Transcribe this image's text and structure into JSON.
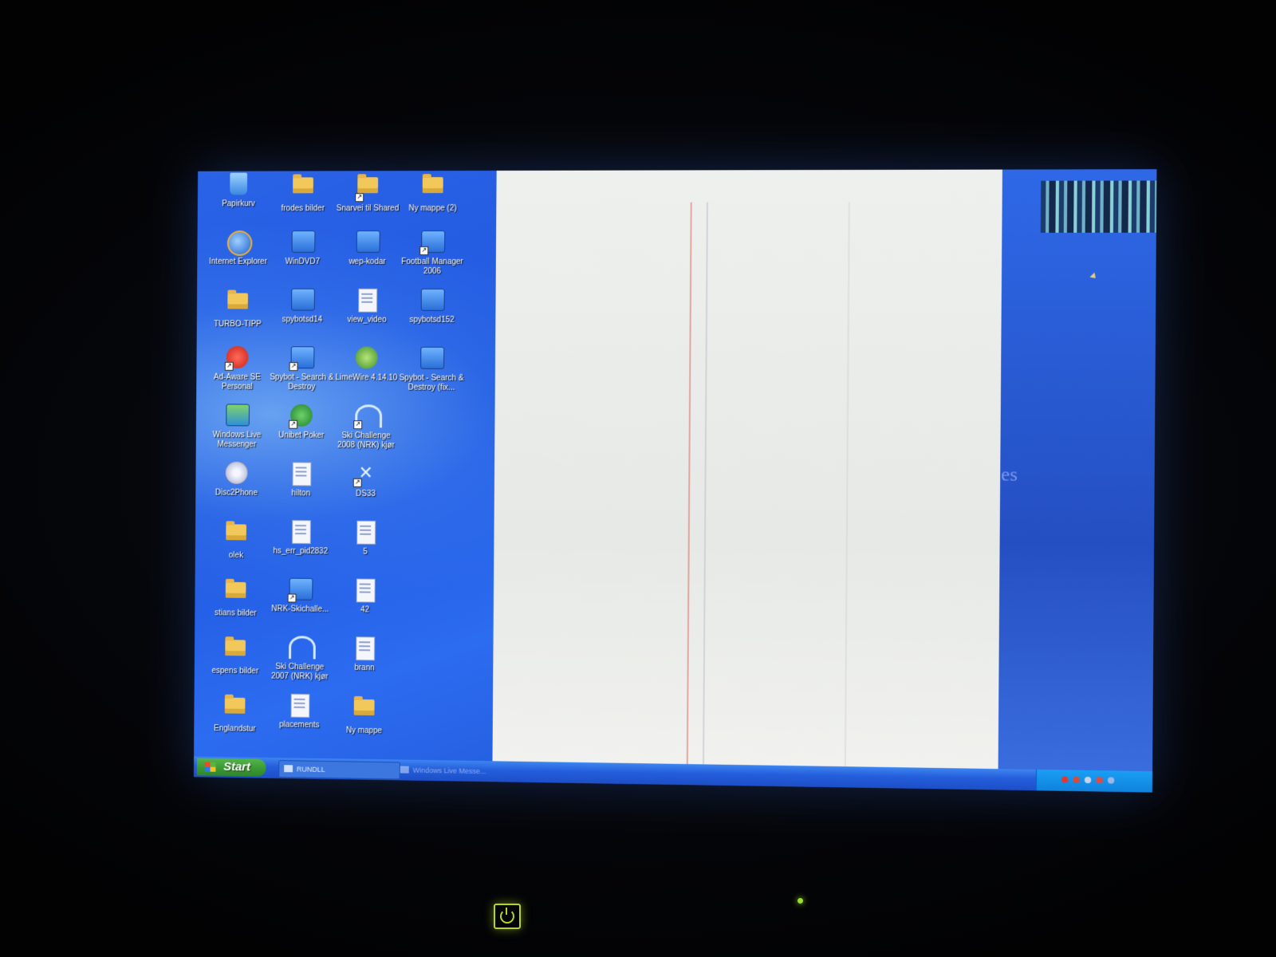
{
  "desktop": {
    "icons": [
      {
        "label": "Papirkurv",
        "type": "recycle"
      },
      {
        "label": "frodes bilder",
        "type": "folder"
      },
      {
        "label": "Snarvei til Shared",
        "type": "folder",
        "shortcut": true
      },
      {
        "label": "Ny mappe (2)",
        "type": "folder"
      },
      {
        "label": "Internet Explorer",
        "type": "ie"
      },
      {
        "label": "WinDVD7",
        "type": "app"
      },
      {
        "label": "wep-kodar",
        "type": "app"
      },
      {
        "label": "Football Manager 2006",
        "type": "app",
        "shortcut": true
      },
      {
        "label": "TURBO-TIPP",
        "type": "folder"
      },
      {
        "label": "spybotsd14",
        "type": "app"
      },
      {
        "label": "view_video",
        "type": "doc"
      },
      {
        "label": "spybotsd152",
        "type": "app"
      },
      {
        "label": "Ad-Aware SE Personal",
        "type": "adaware",
        "shortcut": true
      },
      {
        "label": "Spybot - Search & Destroy",
        "type": "app",
        "shortcut": true
      },
      {
        "label": "LimeWire 4.14.10",
        "type": "limewire"
      },
      {
        "label": "Spybot - Search & Destroy (fix...",
        "type": "app"
      },
      {
        "label": "Windows Live Messenger",
        "type": "messenger"
      },
      {
        "label": "Unibet Poker",
        "type": "poker",
        "shortcut": true
      },
      {
        "label": "Ski Challenge 2008 (NRK) kjør",
        "type": "ski",
        "shortcut": true
      },
      {
        "label": "",
        "type": "empty"
      },
      {
        "label": "Disc2Phone",
        "type": "disc"
      },
      {
        "label": "hilton",
        "type": "doc"
      },
      {
        "label": "DS33",
        "type": "ds",
        "shortcut": true
      },
      {
        "label": "",
        "type": "empty"
      },
      {
        "label": "olek",
        "type": "folder"
      },
      {
        "label": "hs_err_pid2832",
        "type": "doc"
      },
      {
        "label": "5",
        "type": "doc"
      },
      {
        "label": "",
        "type": "empty"
      },
      {
        "label": "stians bilder",
        "type": "folder"
      },
      {
        "label": "NRK-Skichalle...",
        "type": "app",
        "shortcut": true
      },
      {
        "label": "42",
        "type": "doc"
      },
      {
        "label": "",
        "type": "empty"
      },
      {
        "label": "espens bilder",
        "type": "folder"
      },
      {
        "label": "Ski Challenge 2007 (NRK) kjør",
        "type": "ski"
      },
      {
        "label": "brann",
        "type": "doc"
      },
      {
        "label": "",
        "type": "empty"
      },
      {
        "label": "Englandstur",
        "type": "folder"
      },
      {
        "label": "placements",
        "type": "doc"
      },
      {
        "label": "Ny mappe",
        "type": "folder"
      }
    ]
  },
  "taskbar": {
    "start_label": "Start",
    "tasks": [
      {
        "label": "RUNDLL"
      },
      {
        "label": "Windows Live Messe..."
      }
    ]
  },
  "right_text": "es",
  "colors": {
    "desktop_blue": "#1f57df",
    "start_green": "#3a9a34",
    "power_green": "#b8d41c"
  }
}
